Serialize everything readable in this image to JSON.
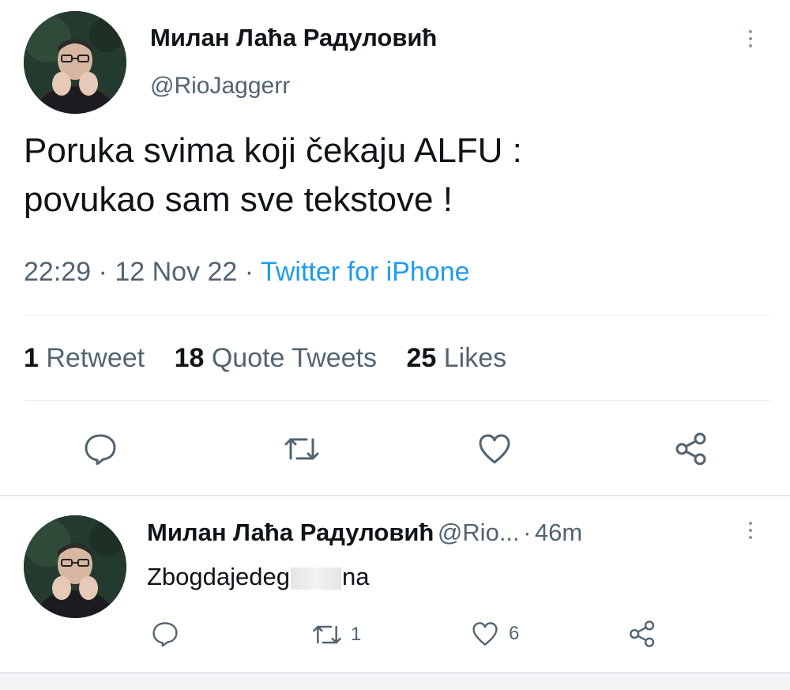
{
  "tweet": {
    "author_name": "Милан Лаћа Радуловић",
    "handle": "@RioJaggerr",
    "text_line1": "Poruka svima koji čekaju ALFU :",
    "text_line2": "povukao sam sve tekstove !",
    "time": "22:29",
    "date": "12 Nov 22",
    "source": "Twitter for iPhone",
    "separator": "·",
    "stats": {
      "retweets_count": "1",
      "retweets_label": "Retweet",
      "quotes_count": "18",
      "quotes_label": "Quote Tweets",
      "likes_count": "25",
      "likes_label": "Likes"
    }
  },
  "reply": {
    "author_name": "Милан Лаћа Радуловић",
    "handle": "@Rio...",
    "separator": "·",
    "age": "46m",
    "text_start": "Zbogdajedeg",
    "text_end": "na",
    "retweet_count": "1",
    "like_count": "6"
  },
  "icons": {
    "more": "more-vertical-icon",
    "reply": "speech-bubble-icon",
    "retweet": "retweet-icon",
    "like": "heart-icon",
    "share": "share-icon"
  },
  "colors": {
    "link": "#1d9bf0",
    "secondary_text": "#536471",
    "divider": "#e6ecf0"
  }
}
